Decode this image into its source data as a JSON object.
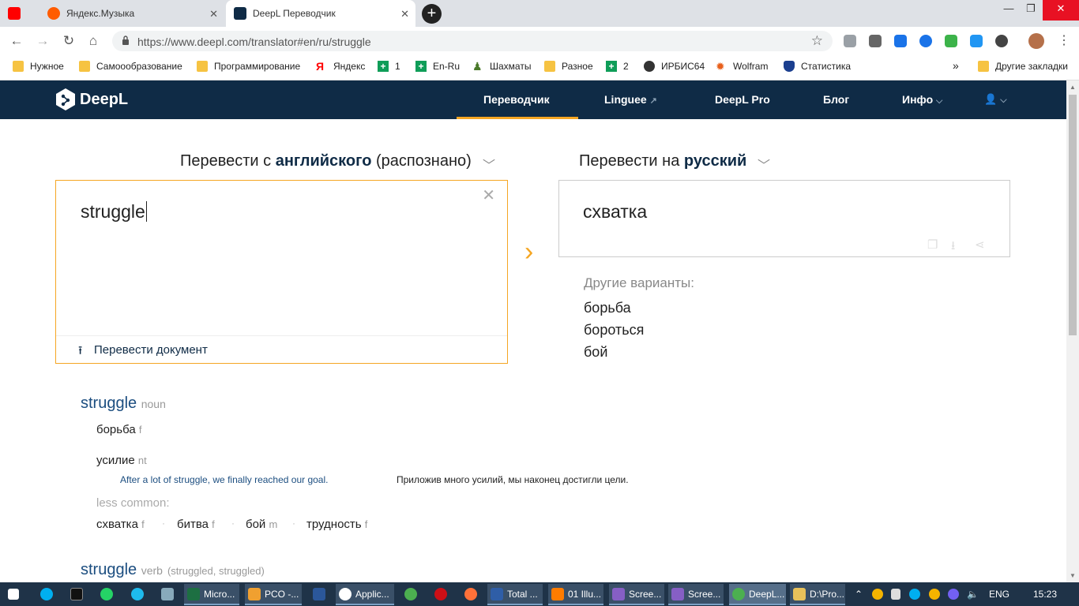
{
  "browser": {
    "tabs": [
      {
        "label": "",
        "favicon_color": "#ff0000"
      },
      {
        "label": "Яндекс.Музыка",
        "favicon_color": "#ff5c00"
      },
      {
        "label": "DeepL Переводчик",
        "favicon_color": "#0f2b46"
      }
    ],
    "url": "https://www.deepl.com/translator#en/ru/struggle",
    "bookmarks": [
      {
        "label": "Нужное",
        "icon": "folder-icon"
      },
      {
        "label": "Самоообразование",
        "icon": "folder-icon"
      },
      {
        "label": "Программирование",
        "icon": "folder-icon"
      },
      {
        "label": "Яндекс",
        "icon": "yandex-icon"
      },
      {
        "label": "1",
        "icon": "sheets-icon"
      },
      {
        "label": "En-Ru",
        "icon": "sheets-icon"
      },
      {
        "label": "Шахматы",
        "icon": "chess-icon"
      },
      {
        "label": "Разное",
        "icon": "folder-icon"
      },
      {
        "label": "2",
        "icon": "sheets-icon"
      },
      {
        "label": "ИРБИС64",
        "icon": "globe-icon"
      },
      {
        "label": "Wolfram",
        "icon": "wolfram-icon"
      },
      {
        "label": "Статистика",
        "icon": "shield-icon"
      }
    ],
    "bookmarks_more": "»",
    "other_bookmarks": "Другие закладки"
  },
  "deepl": {
    "logo": "DeepL",
    "nav": {
      "translator": "Переводчик",
      "linguee": "Linguee",
      "pro": "DeepL Pro",
      "blog": "Блог",
      "info": "Инфо"
    },
    "source_lang": {
      "prefix": "Перевести с ",
      "lang": "английского",
      "suffix": " (распознано)"
    },
    "target_lang": {
      "prefix": "Перевести на ",
      "lang": "русский"
    },
    "source_text": "struggle",
    "translate_document": "Перевести документ",
    "target_text": "схватка",
    "alternatives_title": "Другие варианты:",
    "alternatives": [
      "борьба",
      "бороться",
      "бой"
    ]
  },
  "dictionary": {
    "noun": {
      "word": "struggle",
      "pos": "noun",
      "tr1": {
        "word": "борьба",
        "gender": "f"
      },
      "tr2": {
        "word": "усилие",
        "gender": "nt"
      },
      "example_en": "After a lot of struggle, we finally reached our goal.",
      "example_ru": "Приложив много усилий, мы наконец достигли цели.",
      "less_common_label": "less common:",
      "less_common": [
        {
          "word": "схватка",
          "gender": "f"
        },
        {
          "word": "битва",
          "gender": "f"
        },
        {
          "word": "бой",
          "gender": "m"
        },
        {
          "word": "трудность",
          "gender": "f"
        }
      ]
    },
    "verb": {
      "word": "struggle",
      "pos": "verb",
      "forms": "(struggled, struggled)"
    }
  },
  "taskbar": {
    "buttons": [
      "Micro...",
      "PCO -...",
      "Applic...",
      "Total ...",
      "01 Illu...",
      "Scree...",
      "Scree...",
      "DeepL...",
      "D:\\Pro..."
    ],
    "lang": "ENG",
    "time": "15:23"
  }
}
